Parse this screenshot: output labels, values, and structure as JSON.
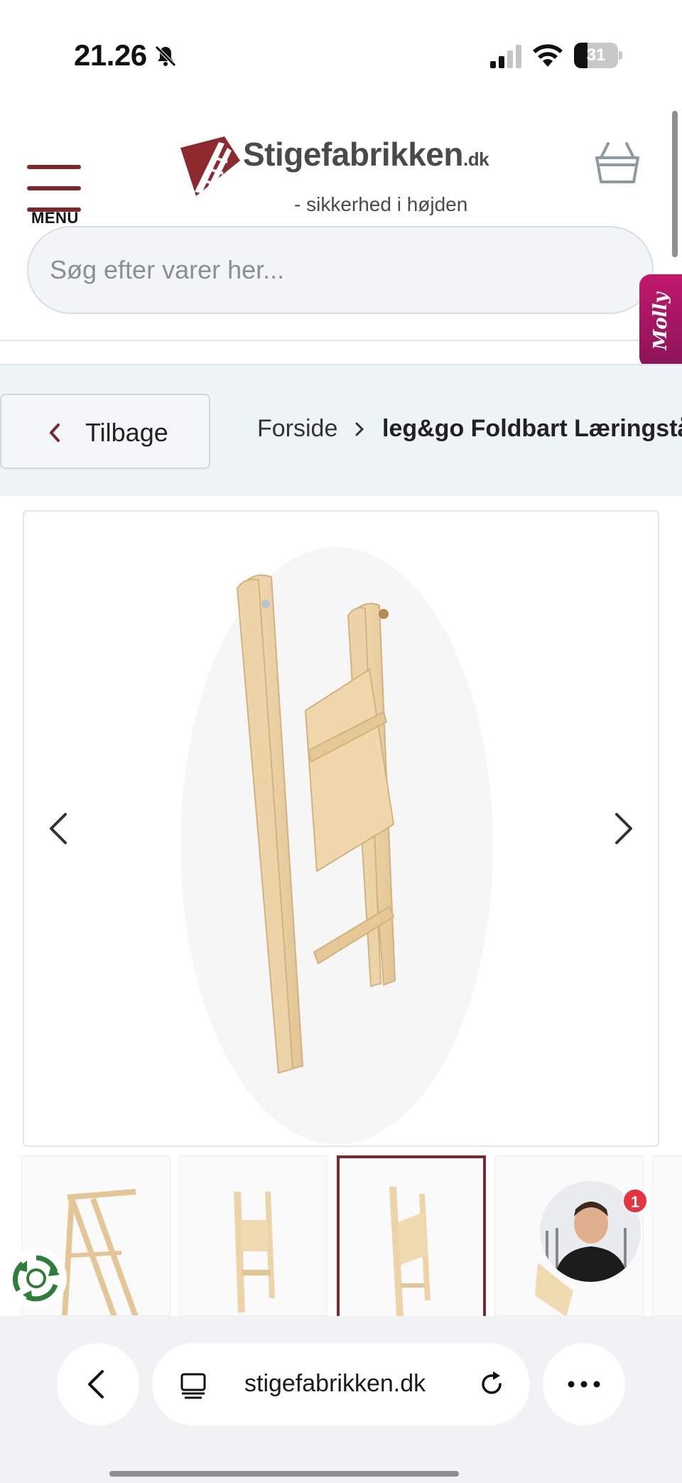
{
  "status_bar": {
    "time": "21.26",
    "battery_pct": "31",
    "battery_level": 0.31,
    "icons": [
      "bell-muted-icon",
      "cellular-signal-icon",
      "wifi-icon",
      "battery-icon"
    ]
  },
  "header": {
    "menu_label": "MENU",
    "logo_name": "Stigefabrikken",
    "logo_tld": ".dk",
    "logo_tagline": "- sikkerhed i højden",
    "cart_icon": "basket-icon",
    "search_placeholder": "Søg efter varer her...",
    "search_value": ""
  },
  "chat_tab": {
    "label": "Molly"
  },
  "breadcrumb": {
    "back_label": "Tilbage",
    "home": "Forside",
    "current": "leg&go Foldbart Læringstå"
  },
  "gallery": {
    "active_index": 2,
    "thumbnail_count": 5,
    "prev_icon": "chevron-left-icon",
    "next_icon": "chevron-right-icon"
  },
  "chat_widget": {
    "badge_count": "1"
  },
  "browser": {
    "url": "stigefabrikken.dk",
    "icons": [
      "back-icon",
      "tabs-icon",
      "reload-icon",
      "more-icon"
    ]
  },
  "colors": {
    "brand": "#7a2a2d",
    "molly": "#c2186b",
    "badge": "#e53340",
    "band": "#eef3f5"
  }
}
